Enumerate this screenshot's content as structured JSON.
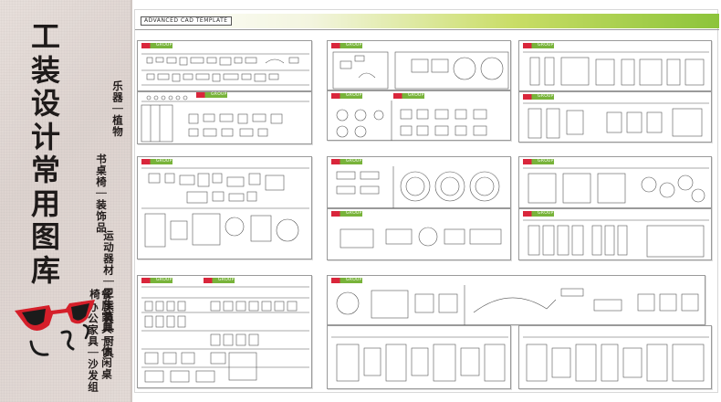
{
  "title_chars": [
    "工",
    "装",
    "设",
    "计",
    "常",
    "用",
    "图",
    "库"
  ],
  "categories": {
    "col1": [
      "办公家具",
      "沙发组合"
    ],
    "col2": [
      "餐厅家具",
      "休闲桌椅"
    ],
    "col3": [
      "床具",
      "厨具"
    ],
    "col4": [
      "运动器材",
      "卫生洁具"
    ],
    "col5": [
      "书桌椅",
      "装饰品"
    ],
    "col6": [
      "乐器",
      "植物"
    ]
  },
  "sheet": {
    "banner": "ADVANCED  CAD  TEMPLATE",
    "card_tag": "GROUP"
  },
  "colors": {
    "tag_red": "#d9263b",
    "tag_green": "#78b33a",
    "banner_green": "#8cc43a",
    "sunglasses": "#d51f2a"
  }
}
